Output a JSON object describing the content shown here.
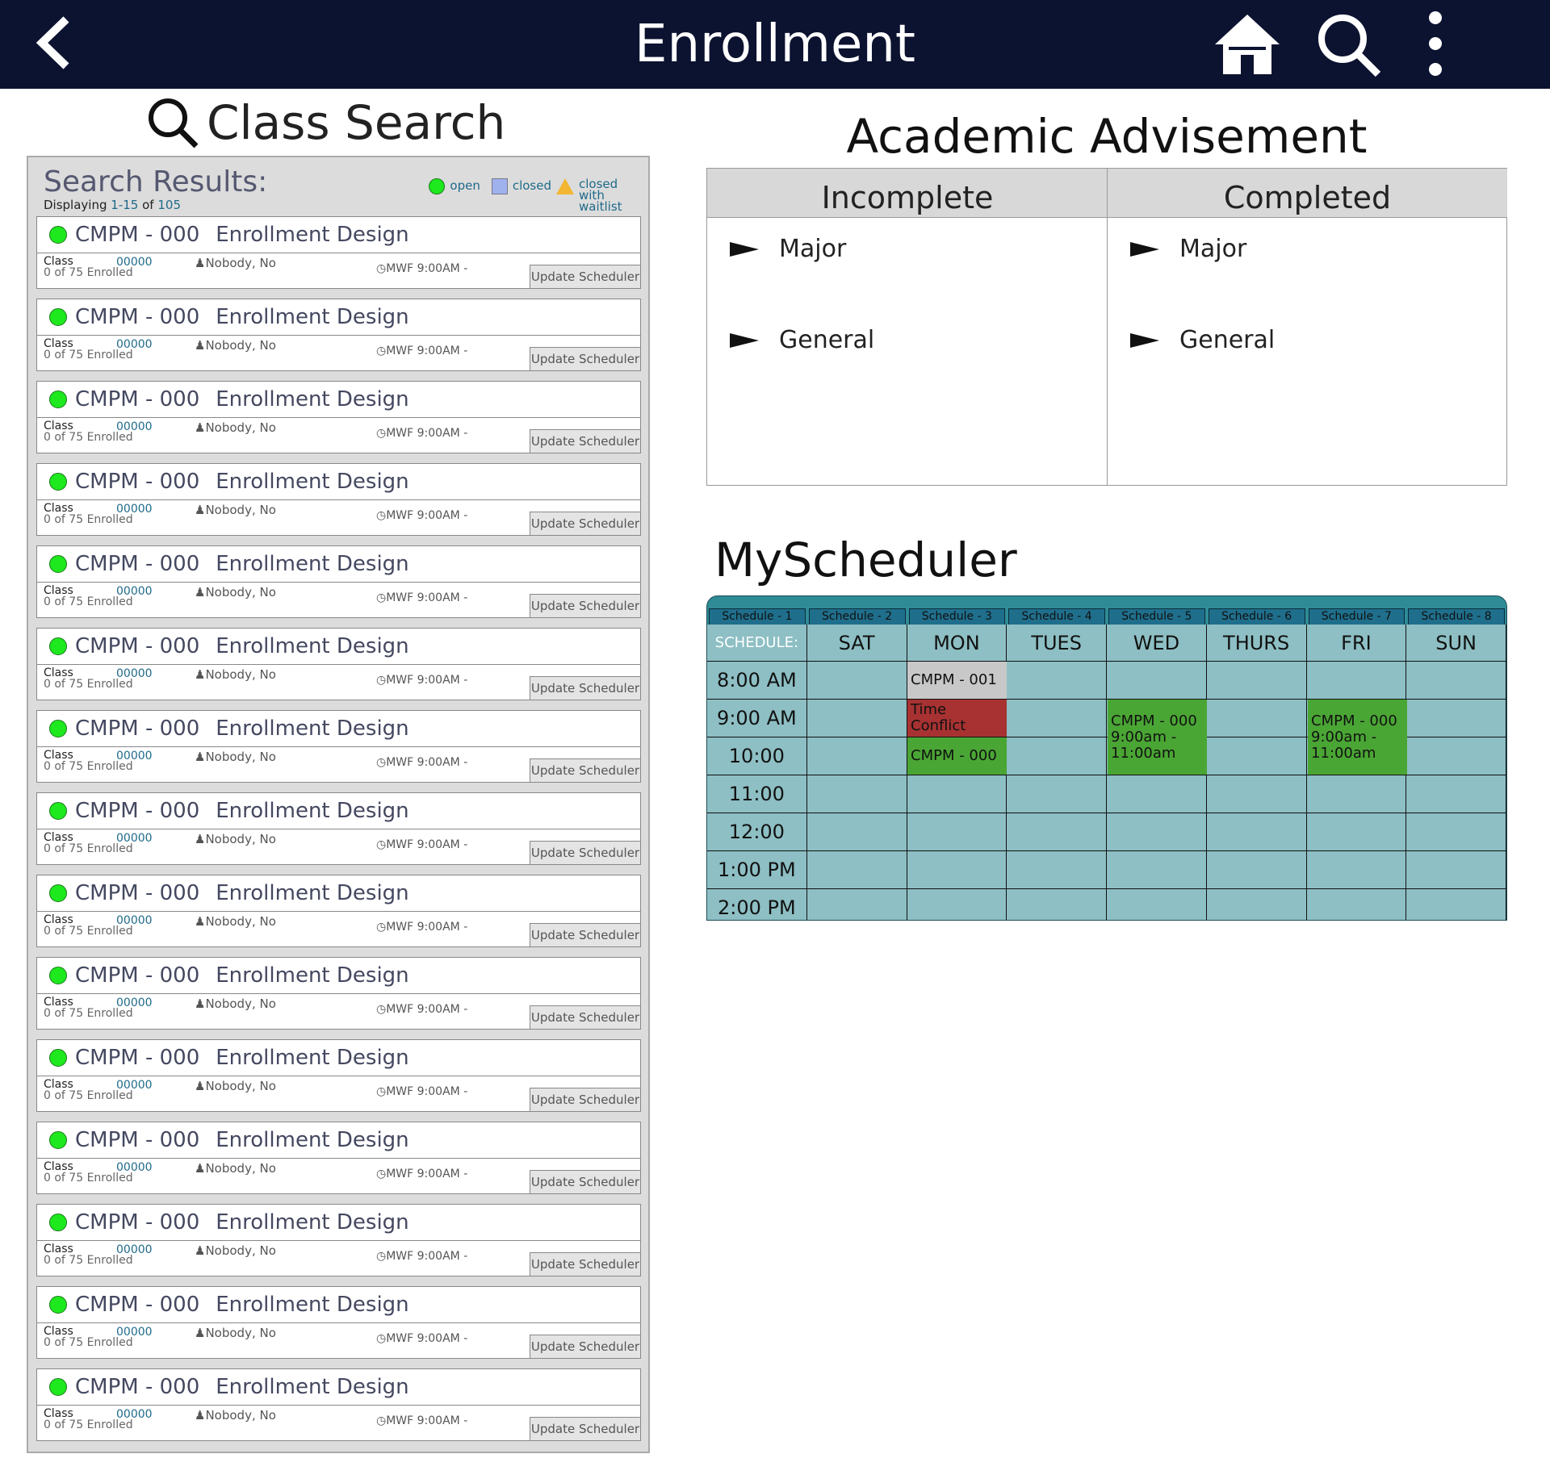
{
  "header": {
    "title": "Enrollment",
    "icons": [
      "back-chevron-icon",
      "home-icon",
      "search-icon",
      "more-vertical-icon"
    ]
  },
  "class_search": {
    "title": "Class Search",
    "results_title": "Search Results:",
    "displaying_label": "Displaying",
    "range": "1-15",
    "of": "of",
    "total": "105",
    "legend": {
      "open": "open",
      "closed": "closed",
      "waitlist": "closed with waitlist"
    },
    "results": [
      {
        "code": "CMPM - 000",
        "name": "Enrollment Design",
        "class_label": "Class",
        "class_num": "00000",
        "enrolled": "0 of 75 Enrolled",
        "instructor": "Nobody, No",
        "time": "MWF 9:00AM -",
        "button": "Update Scheduler"
      }
    ],
    "result_count": 15
  },
  "advisement": {
    "title": "Academic Advisement",
    "columns": [
      {
        "header": "Incomplete",
        "items": [
          "Major",
          "General"
        ]
      },
      {
        "header": "Completed",
        "items": [
          "Major",
          "General"
        ]
      }
    ]
  },
  "scheduler": {
    "title": "MyScheduler",
    "tabs": [
      "Schedule - 1",
      "Schedule - 2",
      "Schedule - 3",
      "Schedule - 4",
      "Schedule - 5",
      "Schedule - 6",
      "Schedule - 7",
      "Schedule - 8"
    ],
    "corner": "SCHEDULE:",
    "days": [
      "SAT",
      "MON",
      "TUES",
      "WED",
      "THURS",
      "FRI",
      "SUN"
    ],
    "times": [
      "8:00 AM",
      "9:00 AM",
      "10:00",
      "11:00",
      "12:00",
      "1:00 PM",
      "2:00 PM"
    ],
    "events": [
      {
        "text": "CMPM - 001",
        "day": "MON",
        "start": 0,
        "span": 1,
        "color": "#c8c8c8"
      },
      {
        "text": "Time Conflict",
        "day": "MON",
        "start": 1,
        "span": 1,
        "color": "#a83232"
      },
      {
        "text": "CMPM - 000",
        "day": "MON",
        "start": 2,
        "span": 1,
        "color": "#4aa634"
      },
      {
        "text": "CMPM - 000\n9:00am -\n11:00am",
        "day": "WED",
        "start": 1,
        "span": 2,
        "color": "#4aa634"
      },
      {
        "text": "CMPM - 000\n9:00am -\n11:00am",
        "day": "FRI",
        "start": 1,
        "span": 2,
        "color": "#4aa634"
      }
    ]
  }
}
